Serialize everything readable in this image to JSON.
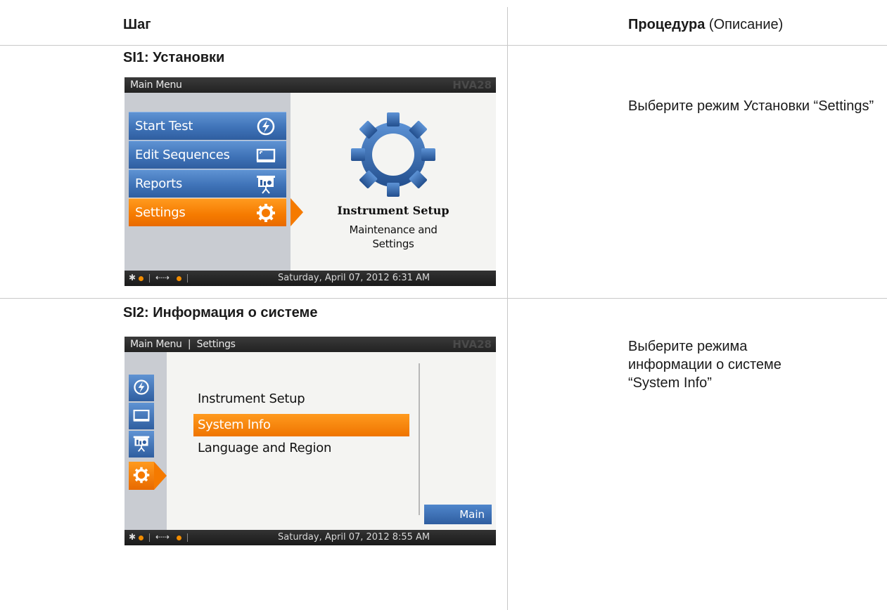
{
  "header": {
    "step_col": "Шаг",
    "proc_col_bold": "Процедура",
    "proc_col_rest": " (Описание)"
  },
  "steps": [
    {
      "title": "SI1: Установки",
      "description": "Выберите режим Установки “Settings”",
      "screen": {
        "title": "Main Menu",
        "brand": "HVA28",
        "menu": [
          "Start Test",
          "Edit Sequences",
          "Reports",
          "Settings"
        ],
        "selected_index": 3,
        "info_title": "Instrument Setup",
        "info_subtitle_line1": "Maintenance and",
        "info_subtitle_line2": "Settings",
        "datetime": "Saturday, April 07, 2012 6:31 AM"
      }
    },
    {
      "title": "SI2: Информация о системе",
      "description_line1": "Выберите режима",
      "description_line2": "информации о системе",
      "description_line3": "“System Info”",
      "screen": {
        "title": "Main Menu  |  Settings",
        "brand": "HVA28",
        "list": [
          "Instrument Setup",
          "System Info",
          "Language and Region"
        ],
        "selected_index": 1,
        "main_button": "Main",
        "datetime": "Saturday, April 07, 2012 8:55 AM"
      }
    }
  ],
  "colors": {
    "accent_orange": "#f57a00",
    "button_blue": "#3f73b8",
    "status_dot": "#f28c00"
  }
}
